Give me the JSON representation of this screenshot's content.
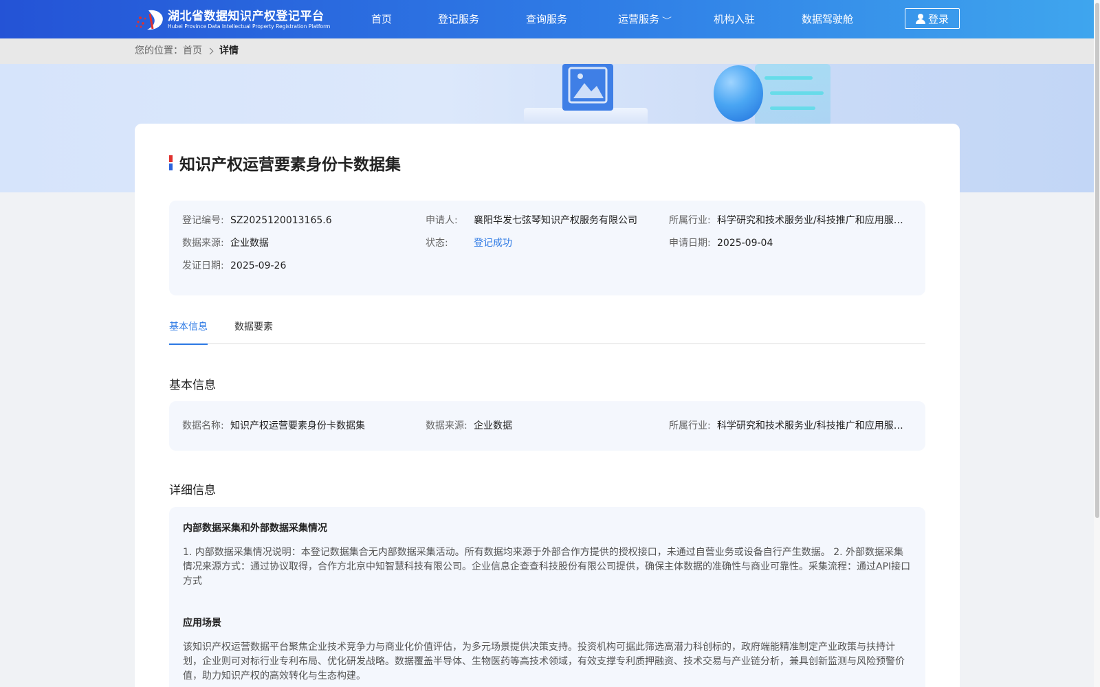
{
  "header": {
    "logo_cn": "湖北省数据知识产权登记平台",
    "logo_en": "Hubei Province Data Intellectual Property Registration Platform",
    "nav": [
      {
        "label": "首页"
      },
      {
        "label": "登记服务"
      },
      {
        "label": "查询服务"
      },
      {
        "label": "运营服务",
        "has_dropdown": true
      },
      {
        "label": "机构入驻"
      },
      {
        "label": "数据驾驶舱"
      }
    ],
    "login_label": "登录"
  },
  "breadcrumb": {
    "prefix": "您的位置：",
    "home": "首页",
    "current": "详情"
  },
  "detail": {
    "title": "知识产权运营要素身份卡数据集",
    "summary": {
      "reg_no_label": "登记编号:",
      "reg_no": "SZ2025120013165.6",
      "applicant_label": "申请人:",
      "applicant": "襄阳华发七弦琴知识产权服务有限公司",
      "industry_label": "所属行业:",
      "industry": "科学研究和技术服务业/科技推广和应用服务业",
      "source_label": "数据来源:",
      "source": "企业数据",
      "status_label": "状态:",
      "status": "登记成功",
      "apply_date_label": "申请日期:",
      "apply_date": "2025-09-04",
      "issue_date_label": "发证日期:",
      "issue_date": "2025-09-26"
    },
    "tabs": [
      {
        "label": "基本信息",
        "active": true
      },
      {
        "label": "数据要素",
        "active": false
      }
    ],
    "basic": {
      "heading": "基本信息",
      "name_label": "数据名称:",
      "name": "知识产权运营要素身份卡数据集",
      "source_label": "数据来源:",
      "source": "企业数据",
      "industry_label": "所属行业:",
      "industry": "科学研究和技术服务业/科技推广和应用服务业"
    },
    "extra": {
      "heading": "详细信息",
      "collect_heading": "内部数据采集和外部数据采集情况",
      "collect_text": "1. 内部数据采集情况说明：本登记数据集合无内部数据采集活动。所有数据均来源于外部合作方提供的授权接口，未通过自营业务或设备自行产生数据。 2. 外部数据采集情况来源方式：通过协议取得，合作方北京中知智慧科技有限公司。企业信息企查查科技股份有限公司提供，确保主体数据的准确性与商业可靠性。采集流程：通过API接口方式",
      "scene_heading": "应用场景",
      "scene_text": "该知识产权运营数据平台聚焦企业技术竞争力与商业化价值评估，为多元场景提供决策支持。投资机构可据此筛选高潜力科创标的，政府端能精准制定产业政策与扶持计划，企业则可对标行业专利布局、优化研发战略。数据覆盖半导体、生物医药等高技术领域，有效支撑专利质押融资、技术交易与产业链分析，兼具创新监测与风险预警价值，助力知识产权的高效转化与生态构建。"
    }
  },
  "colors": {
    "primary": "#2b78e4",
    "header_start": "#2453d6",
    "header_end": "#3fa6ee",
    "box_bg": "#f4f7fd"
  }
}
